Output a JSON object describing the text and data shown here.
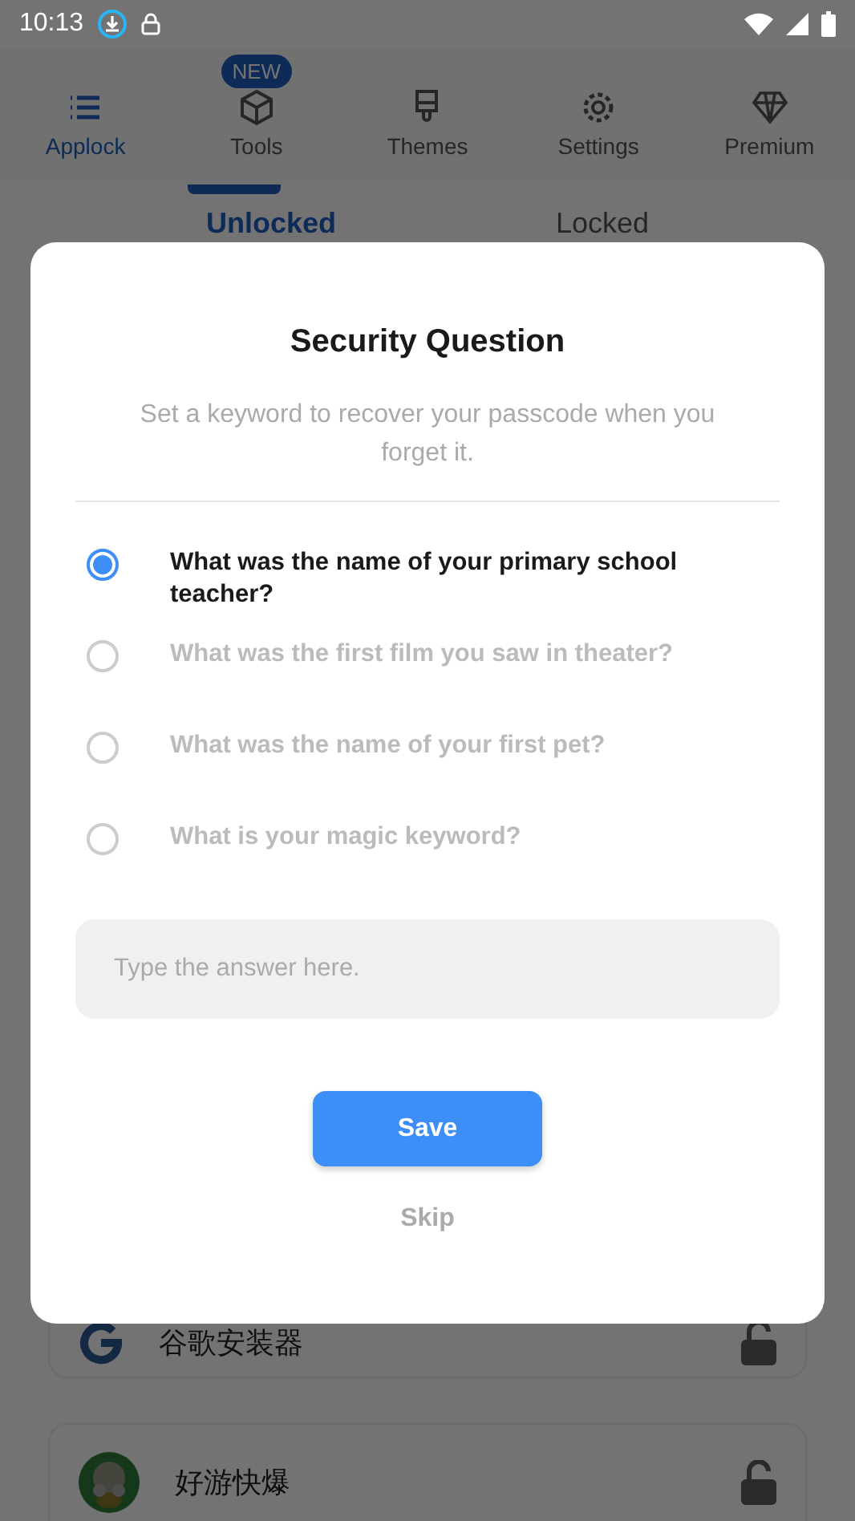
{
  "status_bar": {
    "time": "10:13"
  },
  "tabs": [
    {
      "label": "Applock",
      "selected": true
    },
    {
      "label": "Tools",
      "selected": false,
      "badge": "NEW"
    },
    {
      "label": "Themes",
      "selected": false
    },
    {
      "label": "Settings",
      "selected": false
    },
    {
      "label": "Premium",
      "selected": false
    }
  ],
  "filter_tabs": [
    {
      "label": "Unlocked",
      "selected": true
    },
    {
      "label": "Locked",
      "selected": false
    }
  ],
  "apps": [
    {
      "name": "谷歌安装器",
      "locked": false
    },
    {
      "name": "好游快爆",
      "locked": false
    }
  ],
  "dialog": {
    "title": "Security Question",
    "subtitle": "Set a keyword to recover your passcode when you forget it.",
    "questions": [
      {
        "text": "What was the name of your primary school teacher?",
        "selected": true
      },
      {
        "text": "What was the first film you saw in theater?",
        "selected": false
      },
      {
        "text": "What was the name of your first pet?",
        "selected": false
      },
      {
        "text": "What is your magic keyword?",
        "selected": false
      }
    ],
    "answer": {
      "placeholder": "Type the answer here."
    },
    "save": "Save",
    "skip": "Skip"
  }
}
